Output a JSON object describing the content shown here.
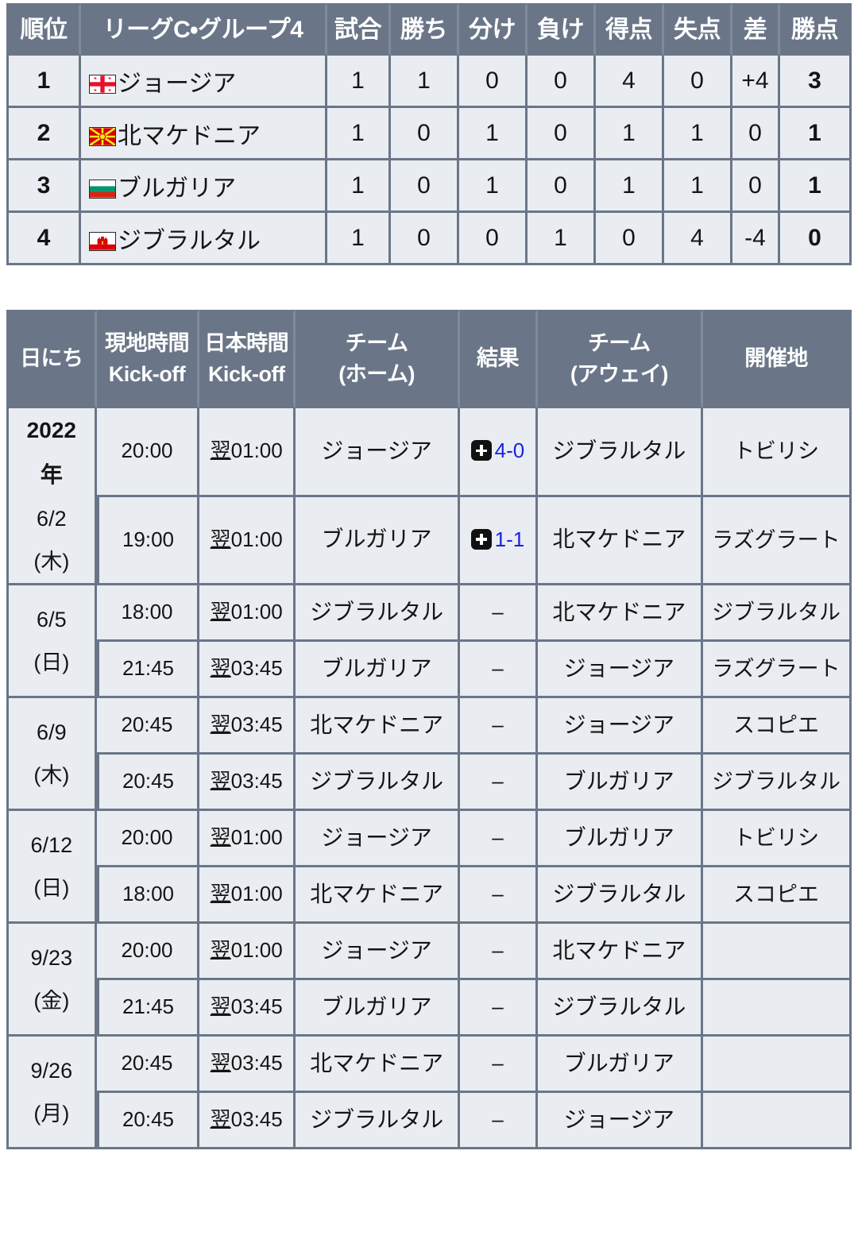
{
  "standings": {
    "headers": [
      "順位",
      "リーグC・グループ4",
      "試合",
      "勝ち",
      "分け",
      "負け",
      "得点",
      "失点",
      "差",
      "勝点"
    ],
    "rows": [
      {
        "rank": "1",
        "flag": "georgia-flag-icon",
        "team": "ジョージア",
        "played": "1",
        "win": "1",
        "draw": "0",
        "loss": "0",
        "gf": "4",
        "ga": "0",
        "gd": "+4",
        "pts": "3"
      },
      {
        "rank": "2",
        "flag": "north-macedonia-flag-icon",
        "team": "北マケドニア",
        "played": "1",
        "win": "0",
        "draw": "1",
        "loss": "0",
        "gf": "1",
        "ga": "1",
        "gd": "0",
        "pts": "1"
      },
      {
        "rank": "3",
        "flag": "bulgaria-flag-icon",
        "team": "ブルガリア",
        "played": "1",
        "win": "0",
        "draw": "1",
        "loss": "0",
        "gf": "1",
        "ga": "1",
        "gd": "0",
        "pts": "1"
      },
      {
        "rank": "4",
        "flag": "gibraltar-flag-icon",
        "team": "ジブラルタル",
        "played": "1",
        "win": "0",
        "draw": "0",
        "loss": "1",
        "gf": "0",
        "ga": "4",
        "gd": "-4",
        "pts": "0"
      }
    ]
  },
  "schedule": {
    "headers": {
      "date": "日にち",
      "local_line1": "現地時間",
      "local_line2": "Kick-off",
      "japan_line1": "日本時間",
      "japan_line2": "Kick-off",
      "home_line1": "チーム",
      "home_line2": "(ホーム)",
      "result": "結果",
      "away_line1": "チーム",
      "away_line2": "(アウェイ)",
      "venue": "開催地"
    },
    "dates": [
      {
        "year": "2022",
        "year_suffix": "年",
        "md": "6/2",
        "dow": "(木)",
        "rows": 2
      },
      {
        "year": "",
        "year_suffix": "",
        "md": "6/5",
        "dow": "(日)",
        "rows": 2
      },
      {
        "year": "",
        "year_suffix": "",
        "md": "6/9",
        "dow": "(木)",
        "rows": 2
      },
      {
        "year": "",
        "year_suffix": "",
        "md": "6/12",
        "dow": "(日)",
        "rows": 2
      },
      {
        "year": "",
        "year_suffix": "",
        "md": "9/23",
        "dow": "(金)",
        "rows": 2
      },
      {
        "year": "",
        "year_suffix": "",
        "md": "9/26",
        "dow": "(月)",
        "rows": 2
      }
    ],
    "matches": [
      {
        "local": "20:00",
        "nextday": "翌",
        "japan": "01:00",
        "home": "ジョージア",
        "has_result": true,
        "result_icon": "plus-square-icon",
        "score": "4-0",
        "away": "ジブラルタル",
        "venue": "トビリシ"
      },
      {
        "local": "19:00",
        "nextday": "翌",
        "japan": "01:00",
        "home": "ブルガリア",
        "has_result": true,
        "result_icon": "plus-square-icon",
        "score": "1-1",
        "away": "北マケドニア",
        "venue": "ラズグラート"
      },
      {
        "local": "18:00",
        "nextday": "翌",
        "japan": "01:00",
        "home": "ジブラルタル",
        "has_result": false,
        "result_icon": "",
        "score": "–",
        "away": "北マケドニア",
        "venue": "ジブラルタル"
      },
      {
        "local": "21:45",
        "nextday": "翌",
        "japan": "03:45",
        "home": "ブルガリア",
        "has_result": false,
        "result_icon": "",
        "score": "–",
        "away": "ジョージア",
        "venue": "ラズグラート"
      },
      {
        "local": "20:45",
        "nextday": "翌",
        "japan": "03:45",
        "home": "北マケドニア",
        "has_result": false,
        "result_icon": "",
        "score": "–",
        "away": "ジョージア",
        "venue": "スコピエ"
      },
      {
        "local": "20:45",
        "nextday": "翌",
        "japan": "03:45",
        "home": "ジブラルタル",
        "has_result": false,
        "result_icon": "",
        "score": "–",
        "away": "ブルガリア",
        "venue": "ジブラルタル"
      },
      {
        "local": "20:00",
        "nextday": "翌",
        "japan": "01:00",
        "home": "ジョージア",
        "has_result": false,
        "result_icon": "",
        "score": "–",
        "away": "ブルガリア",
        "venue": "トビリシ"
      },
      {
        "local": "18:00",
        "nextday": "翌",
        "japan": "01:00",
        "home": "北マケドニア",
        "has_result": false,
        "result_icon": "",
        "score": "–",
        "away": "ジブラルタル",
        "venue": "スコピエ"
      },
      {
        "local": "20:00",
        "nextday": "翌",
        "japan": "01:00",
        "home": "ジョージア",
        "has_result": false,
        "result_icon": "",
        "score": "–",
        "away": "北マケドニア",
        "venue": ""
      },
      {
        "local": "21:45",
        "nextday": "翌",
        "japan": "03:45",
        "home": "ブルガリア",
        "has_result": false,
        "result_icon": "",
        "score": "–",
        "away": "ジブラルタル",
        "venue": ""
      },
      {
        "local": "20:45",
        "nextday": "翌",
        "japan": "03:45",
        "home": "北マケドニア",
        "has_result": false,
        "result_icon": "",
        "score": "–",
        "away": "ブルガリア",
        "venue": ""
      },
      {
        "local": "20:45",
        "nextday": "翌",
        "japan": "03:45",
        "home": "ジブラルタル",
        "has_result": false,
        "result_icon": "",
        "score": "–",
        "away": "ジョージア",
        "venue": ""
      }
    ]
  },
  "colors": {
    "header_bg": "#6a7688",
    "cell_bg": "#e9edf1",
    "border": "#6a7688",
    "score_text": "#1822e0",
    "page_bg": "#ffffff"
  }
}
